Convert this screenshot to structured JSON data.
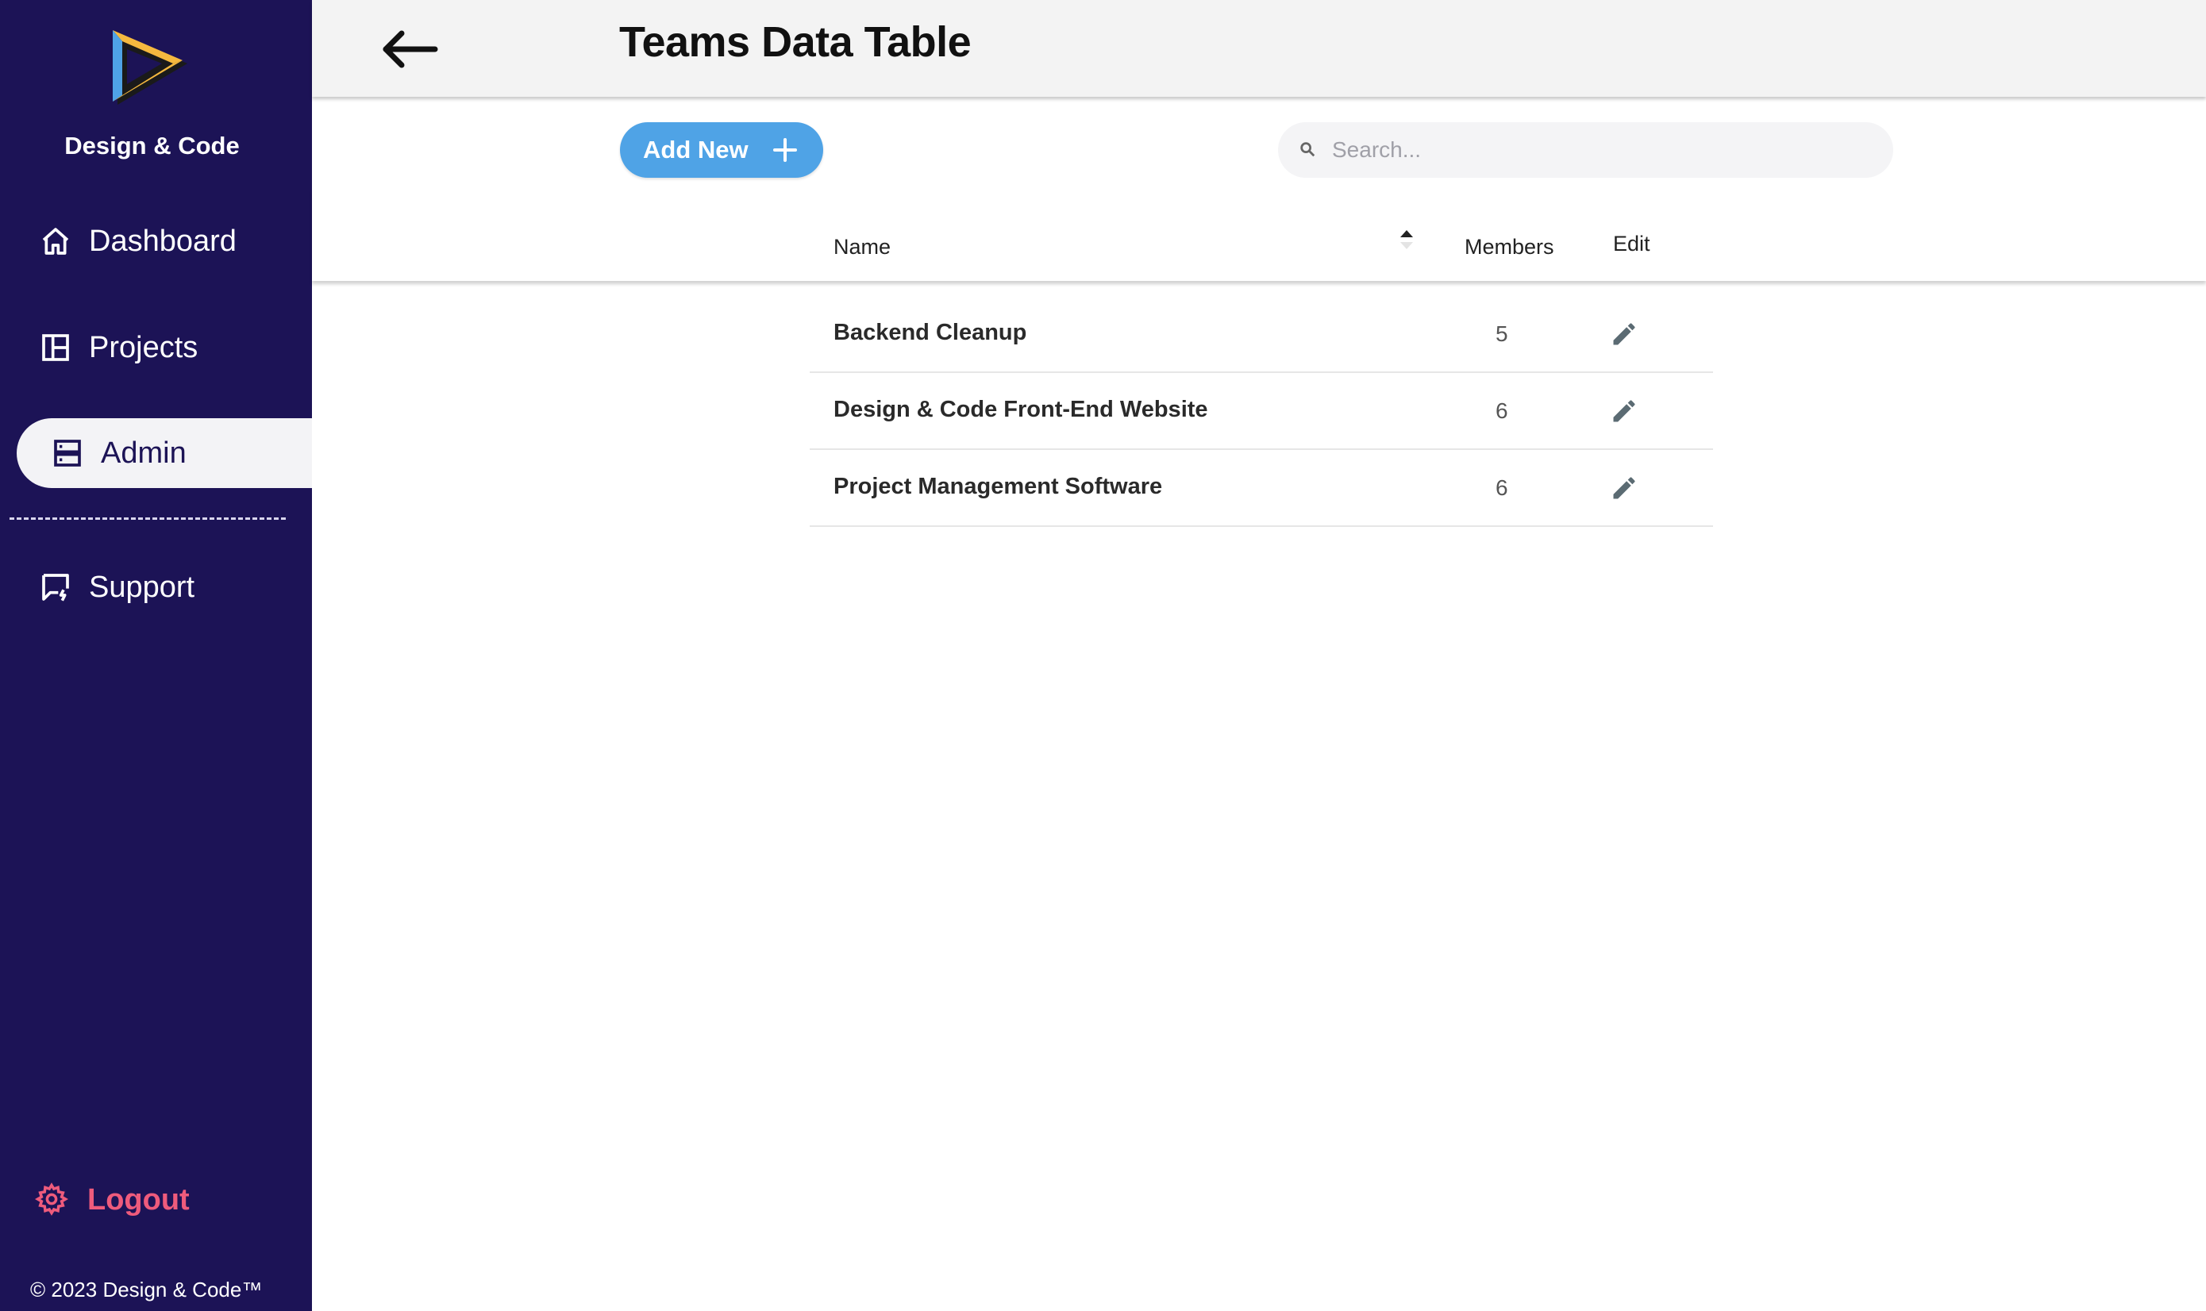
{
  "sidebar": {
    "brand": "Design & Code",
    "items": [
      {
        "label": "Dashboard",
        "icon": "home-icon"
      },
      {
        "label": "Projects",
        "icon": "projects-icon"
      },
      {
        "label": "Admin",
        "icon": "admin-icon",
        "active": true
      },
      {
        "label": "Support",
        "icon": "support-icon"
      }
    ],
    "logout": "Logout",
    "copyright": "© 2023 Design & Code™"
  },
  "header": {
    "title": "Teams Data Table"
  },
  "toolbar": {
    "add_label": "Add New",
    "search_placeholder": "Search..."
  },
  "table": {
    "columns": [
      "Name",
      "Members",
      "Edit"
    ],
    "rows": [
      {
        "name": "Backend Cleanup",
        "members": "5"
      },
      {
        "name": "Design & Code Front-End Website",
        "members": "6"
      },
      {
        "name": "Project Management Software",
        "members": "6"
      }
    ]
  },
  "colors": {
    "sidebar_bg": "#1c1356",
    "accent_blue": "#4fa3e6",
    "logout_pink": "#ee5b7c"
  }
}
